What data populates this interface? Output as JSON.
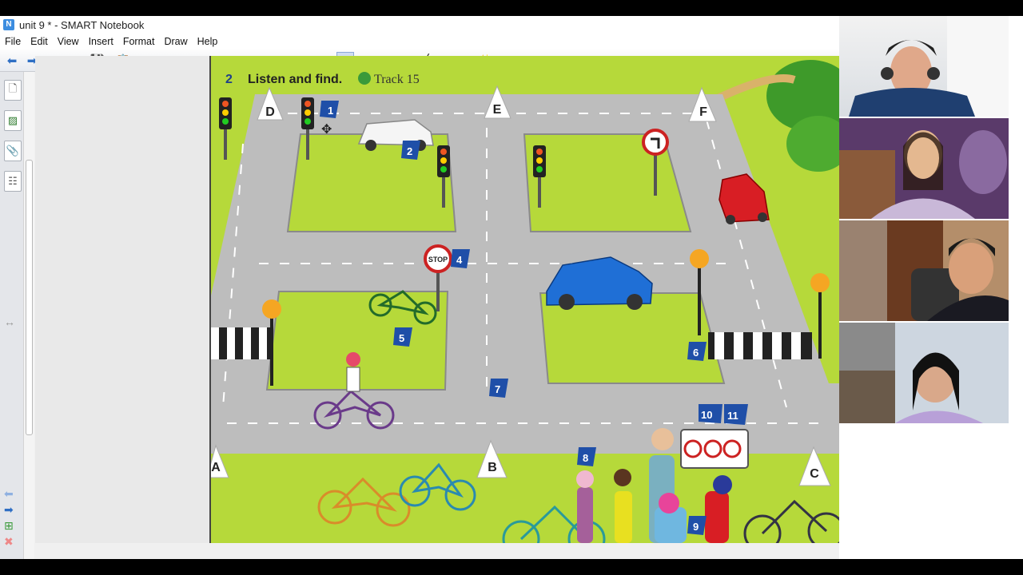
{
  "window": {
    "title": "unit 9 * - SMART Notebook",
    "icon": "smart-notebook-icon"
  },
  "menu": [
    "File",
    "Edit",
    "View",
    "Insert",
    "Format",
    "Draw",
    "Help"
  ],
  "toolbar": {
    "buttons": [
      "back-icon",
      "forward-icon",
      "add-page-icon",
      "open-folder-icon",
      "save-icon",
      "paste-icon",
      "undo-icon",
      "redo-icon",
      "delete-icon",
      "screen-shade-icon",
      "full-screen-icon",
      "display-icon",
      "capture-icon",
      "screen-capture-icon",
      "table-icon",
      "select-arrow-icon",
      "pen-icon",
      "creative-pen-icon",
      "eraser-icon",
      "line-icon",
      "shape-icon",
      "magic-pen-icon",
      "magic-wand-icon",
      "fill-icon",
      "text-icon",
      "properties-icon",
      "move-toolbar-icon"
    ]
  },
  "side_tabs": [
    "page-sorter-icon",
    "gallery-icon",
    "attachments-icon",
    "properties-icon"
  ],
  "exercise": {
    "number": "2",
    "instruction": "Listen and find.",
    "track_number": "15",
    "track_label": "Track 15"
  },
  "map": {
    "cone_letters": [
      "D",
      "E",
      "F",
      "A",
      "B",
      "C"
    ],
    "number_labels": [
      "1",
      "2",
      "4",
      "5",
      "6",
      "7",
      "8",
      "9",
      "10",
      "11"
    ],
    "stop_sign": "STOP",
    "colors": {
      "grass": "#b6d93a",
      "road": "#bdbdbd",
      "label_blue": "#1f4fa8",
      "red_car": "#d81e24",
      "blue_car": "#1f6fd6"
    }
  },
  "webcams": [
    "participant-1-video",
    "participant-2-video",
    "participant-3-video",
    "participant-4-video"
  ]
}
